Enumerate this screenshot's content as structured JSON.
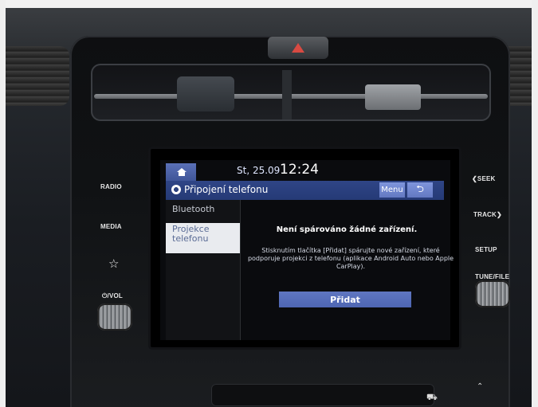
{
  "screen": {
    "date": "St, 25.09",
    "time": "12:24",
    "title": "Připojení telefonu",
    "menu_label": "Menu",
    "back_symbol": "⮌",
    "sidebar": {
      "items": [
        {
          "label": "Bluetooth"
        },
        {
          "label": "Projekce\ntelefonu"
        }
      ]
    },
    "main": {
      "headline": "Není spárováno žádné zařízení.",
      "body": "Stisknutím tlačítka [Přidat] spárujte nové zařízení, které podporuje projekci z telefonu (aplikace Android Auto nebo Apple CarPlay).",
      "add_button": "Přidat"
    }
  },
  "hardware": {
    "left_buttons": {
      "radio": "RADIO",
      "media": "MEDIA",
      "favorite_icon": "star-icon",
      "power_vol": "⏻/VOL"
    },
    "right_buttons": {
      "seek": "❮SEEK",
      "track": "TRACK❯",
      "setup": "SETUP",
      "tune_file": "TUNE/FILE"
    },
    "icons": {
      "hazard": "warning-triangle",
      "car": "car-icon",
      "caret": "chevron-up-icon"
    }
  }
}
